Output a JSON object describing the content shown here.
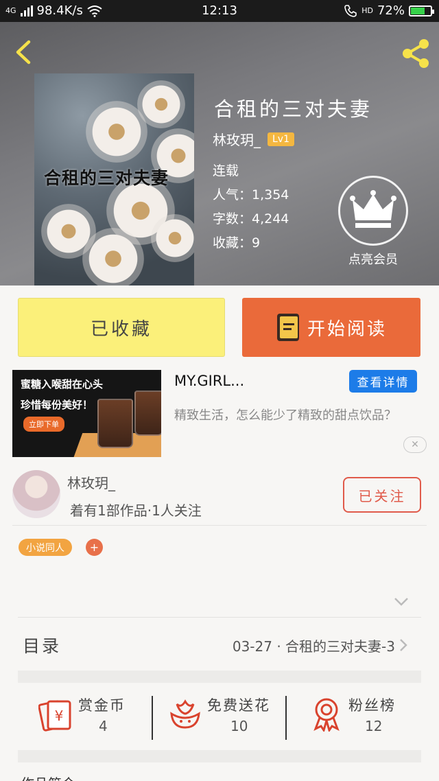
{
  "status_bar": {
    "network": "4G",
    "speed": "98.4K/s",
    "time": "12:13",
    "hd": "HD",
    "battery": "72%",
    "battery_level": 0.72,
    "colors": {
      "battery_fill": "#37d24a"
    }
  },
  "header": {
    "back_icon": "chevron-left-icon",
    "share_icon": "share-icon",
    "cover_text": "合租的三对夫妻"
  },
  "book": {
    "title": "合租的三对夫妻",
    "author": "林玫玥_",
    "level": "Lv1",
    "status": "连载",
    "popularity": "人气：1,354",
    "word_count": "字数：4,244",
    "favorites": "收藏：9"
  },
  "vip": {
    "icon": "crown-icon",
    "label": "点亮会员"
  },
  "actions": {
    "favorite_label": "已收藏",
    "read_label": "开始阅读",
    "read_icon": "book-icon",
    "colors": {
      "favorite_bg": "#fbf07a",
      "read_bg": "#ea6a3a"
    }
  },
  "ad": {
    "image_line1": "蜜糖入喉甜在心头",
    "image_line2": "珍惜每份美好！",
    "image_button": "立即下单",
    "title": "MY.GIRL...",
    "detail_button": "查看详情",
    "description": "精致生活，怎么能少了精致的甜点饮品？",
    "close_label": "✕",
    "colors": {
      "detail_bg": "#1d7ce8"
    }
  },
  "author_section": {
    "name": "林玫玥_",
    "works": "着有1部作品·1人关注",
    "follow_label": "已关注",
    "colors": {
      "follow": "#e05a4a"
    }
  },
  "tags": {
    "items": [
      "小说同人"
    ],
    "add_label": "+"
  },
  "toc": {
    "label": "目录",
    "latest": "03-27 · 合租的三对夫妻-3"
  },
  "stats": [
    {
      "label": "赏金币",
      "value": "4",
      "icon": "red-envelope-icon"
    },
    {
      "label": "免费送花",
      "value": "10",
      "icon": "flower-icon"
    },
    {
      "label": "粉丝榜",
      "value": "12",
      "icon": "award-ribbon-icon"
    }
  ],
  "partial_text": "作品简介"
}
